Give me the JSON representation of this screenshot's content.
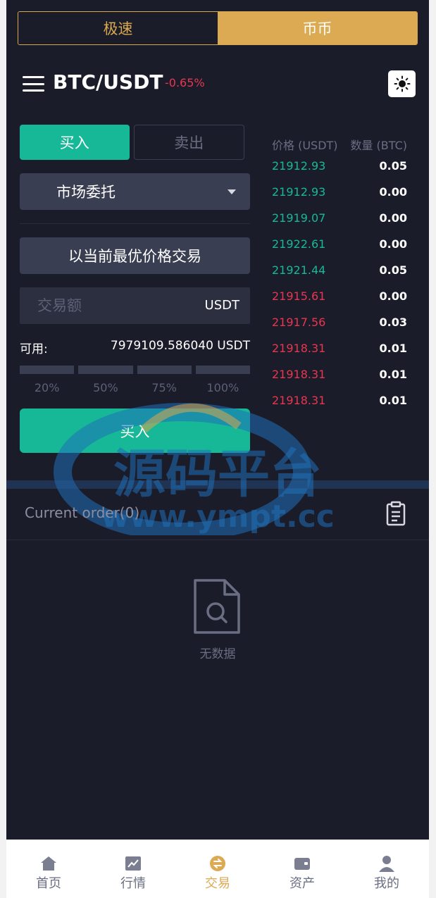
{
  "mode_tabs": [
    {
      "label": "极速",
      "active": false
    },
    {
      "label": "币币",
      "active": true
    }
  ],
  "header": {
    "pair": "BTC/USDT",
    "change": "-0.65%",
    "theme_icon": "sun-icon",
    "menu_icon": "menu-icon"
  },
  "trade": {
    "buy_tab": "买入",
    "sell_tab": "卖出",
    "order_type": "市场委托",
    "best_price_label": "以当前最优价格交易",
    "amount_placeholder": "交易额",
    "amount_unit": "USDT",
    "available_label": "可用:",
    "available_value": "7979109.586040 USDT",
    "percents": [
      "20%",
      "50%",
      "75%",
      "100%"
    ],
    "submit_label": "买入"
  },
  "orderbook": {
    "price_header": "价格 (USDT)",
    "qty_header": "数量 (BTC)",
    "rows": [
      {
        "price": "21912.93",
        "qty": "0.05",
        "side": "buy"
      },
      {
        "price": "21912.93",
        "qty": "0.00",
        "side": "buy"
      },
      {
        "price": "21919.07",
        "qty": "0.00",
        "side": "buy"
      },
      {
        "price": "21922.61",
        "qty": "0.00",
        "side": "buy"
      },
      {
        "price": "21921.44",
        "qty": "0.05",
        "side": "buy"
      },
      {
        "price": "21915.61",
        "qty": "0.00",
        "side": "sell"
      },
      {
        "price": "21917.56",
        "qty": "0.03",
        "side": "sell"
      },
      {
        "price": "21918.31",
        "qty": "0.01",
        "side": "sell"
      },
      {
        "price": "21918.31",
        "qty": "0.01",
        "side": "sell"
      },
      {
        "price": "21918.31",
        "qty": "0.01",
        "side": "sell"
      }
    ]
  },
  "orders": {
    "title": "Current order(0)",
    "empty_text": "无数据"
  },
  "watermark": {
    "title": "源码平台",
    "url": "www.ympt.cc"
  },
  "nav": [
    {
      "label": "首页",
      "icon": "home-icon",
      "active": false
    },
    {
      "label": "行情",
      "icon": "chart-icon",
      "active": false
    },
    {
      "label": "交易",
      "icon": "exchange-icon",
      "active": true
    },
    {
      "label": "资产",
      "icon": "wallet-icon",
      "active": false
    },
    {
      "label": "我的",
      "icon": "user-icon",
      "active": false
    }
  ],
  "colors": {
    "background": "#1b1c2a",
    "accent": "#dcaa52",
    "up": "#17b897",
    "down": "#e8364f"
  }
}
